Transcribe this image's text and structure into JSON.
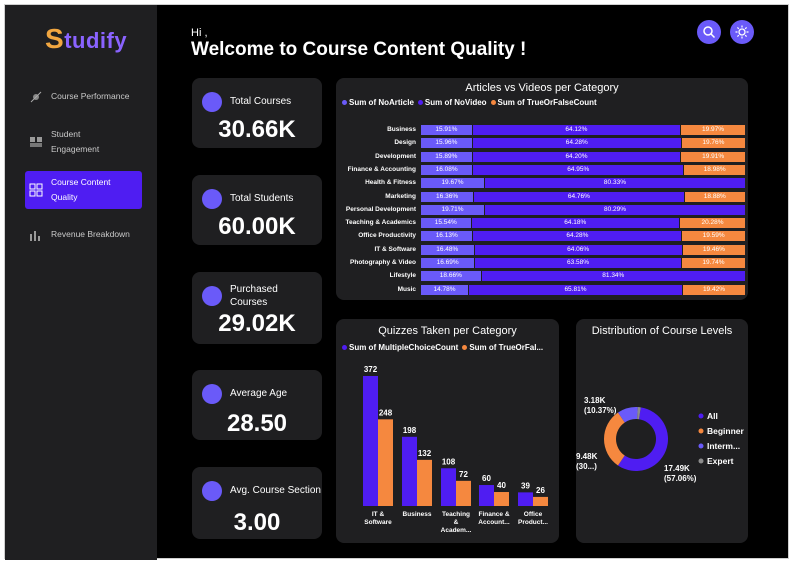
{
  "app": {
    "logo_first": "S",
    "logo_rest": "tudify"
  },
  "sidebar": {
    "items": [
      {
        "label": "Course Performance",
        "icon": "chart-dot-icon"
      },
      {
        "label": "Student Engagement",
        "icon": "people-icon"
      },
      {
        "label": "Course Content Quality",
        "icon": "grid-icon",
        "active": true
      },
      {
        "label": "Revenue Breakdown",
        "icon": "bar-chart-icon"
      }
    ]
  },
  "header": {
    "greeting": "Hi ,",
    "title": "Welcome to Course Content Quality !"
  },
  "kpis": [
    {
      "label": "Total Courses",
      "value": "30.66K",
      "icon": "monitor-icon"
    },
    {
      "label": "Total Students",
      "value": "60.00K",
      "icon": "student-icon"
    },
    {
      "label": "Purchased Courses",
      "value": "29.02K",
      "icon": "cart-icon"
    },
    {
      "label": "Average Age",
      "value": "28.50",
      "icon": "group-icon"
    },
    {
      "label": "Avg. Course Section",
      "value": "3.00",
      "icon": "list-icon"
    }
  ],
  "colors": {
    "accent": "#4f1df2",
    "orange": "#f5883f",
    "purple": "#6a5af9",
    "panel": "#1f1f21"
  },
  "chart_data": [
    {
      "type": "bar",
      "orientation": "horizontal-stacked-100",
      "title": "Articles vs Videos per Category",
      "legend": [
        "Sum of NoArticle",
        "Sum of NoVideo",
        "Sum of TrueOrFalseCount"
      ],
      "categories": [
        "Business",
        "Design",
        "Development",
        "Finance & Accounting",
        "Health & Fitness",
        "Marketing",
        "Personal Development",
        "Teaching & Academics",
        "Office Productivity",
        "IT & Software",
        "Photography & Video",
        "Lifestyle",
        "Music"
      ],
      "series": [
        {
          "name": "Sum of NoArticle",
          "values": [
            15.91,
            15.96,
            15.89,
            16.08,
            19.67,
            16.36,
            19.71,
            15.54,
            16.13,
            16.48,
            16.69,
            18.66,
            14.78
          ]
        },
        {
          "name": "Sum of NoVideo",
          "values": [
            64.12,
            64.28,
            64.2,
            64.95,
            80.33,
            64.76,
            80.29,
            64.18,
            64.28,
            64.06,
            63.58,
            81.34,
            65.81
          ]
        },
        {
          "name": "Sum of TrueOrFalseCount",
          "values": [
            19.97,
            19.76,
            19.91,
            18.98,
            0,
            18.88,
            0,
            20.28,
            19.59,
            19.46,
            19.74,
            0,
            19.42
          ]
        }
      ]
    },
    {
      "type": "bar",
      "title": "Quizzes Taken per Category",
      "legend": [
        "Sum of MultipleChoiceCount",
        "Sum of TrueOrFal..."
      ],
      "categories": [
        "IT & Software",
        "Business",
        "Teaching & Academ...",
        "Finance & Account...",
        "Office Product..."
      ],
      "series": [
        {
          "name": "Sum of MultipleChoiceCount",
          "values": [
            372,
            198,
            108,
            60,
            39
          ]
        },
        {
          "name": "Sum of TrueOrFal...",
          "values": [
            248,
            132,
            72,
            40,
            26
          ]
        }
      ]
    },
    {
      "type": "pie",
      "variant": "donut",
      "title": "Distribution of Course Levels",
      "legend": [
        "All",
        "Beginner",
        "Interm...",
        "Expert"
      ],
      "slices": [
        {
          "name": "All",
          "value": 17.49,
          "label": "17.49K",
          "pct": "(57.06%)"
        },
        {
          "name": "Beginner",
          "value": 9.48,
          "label": "9.48K",
          "pct": "(30...)"
        },
        {
          "name": "Interm...",
          "value": 3.18,
          "label": "3.18K",
          "pct": "(10.37%)"
        },
        {
          "name": "Expert",
          "value": 0.46,
          "label": "",
          "pct": ""
        }
      ],
      "slice_colors": [
        "#4f1df2",
        "#f5883f",
        "#6a5af9",
        "#8c8c8c"
      ]
    }
  ]
}
